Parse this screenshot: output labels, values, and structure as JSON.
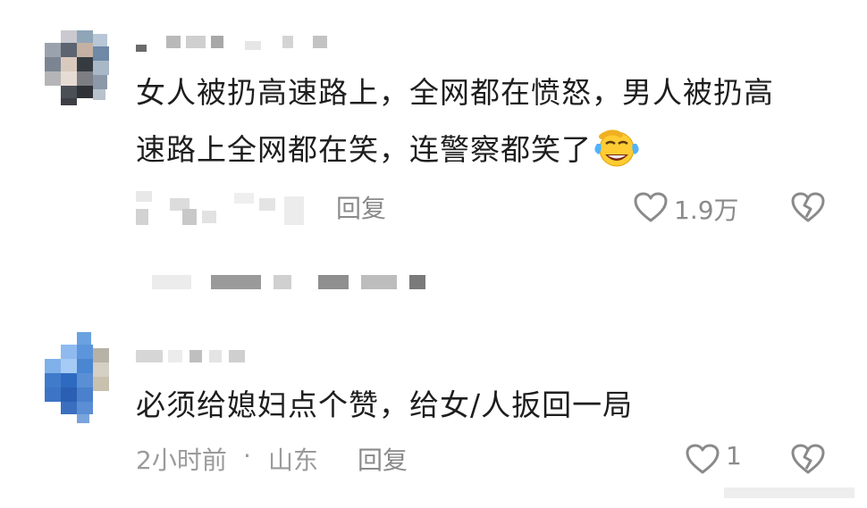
{
  "comments": [
    {
      "text_line1": "女人被扔高速路上，全网都在愤怒，男人被扔高",
      "text_line2": "速路上全网都在笑，连警察都笑了",
      "emoji": "laughing-crying-emoji",
      "reply_label": "回复",
      "likes": "1.9万"
    },
    {
      "text_line1": "必须给媳妇点个赞，给女/人扳回一局",
      "meta_time": "2小时前",
      "meta_sep": "·",
      "meta_location": "山东",
      "reply_label": "回复",
      "likes": "1"
    }
  ],
  "icons": {
    "like": "heart-outline-icon",
    "dislike": "broken-heart-icon"
  },
  "colors": {
    "text": "#1e1e1e",
    "meta": "#9a9a9a",
    "icon": "#8a8a8a"
  }
}
